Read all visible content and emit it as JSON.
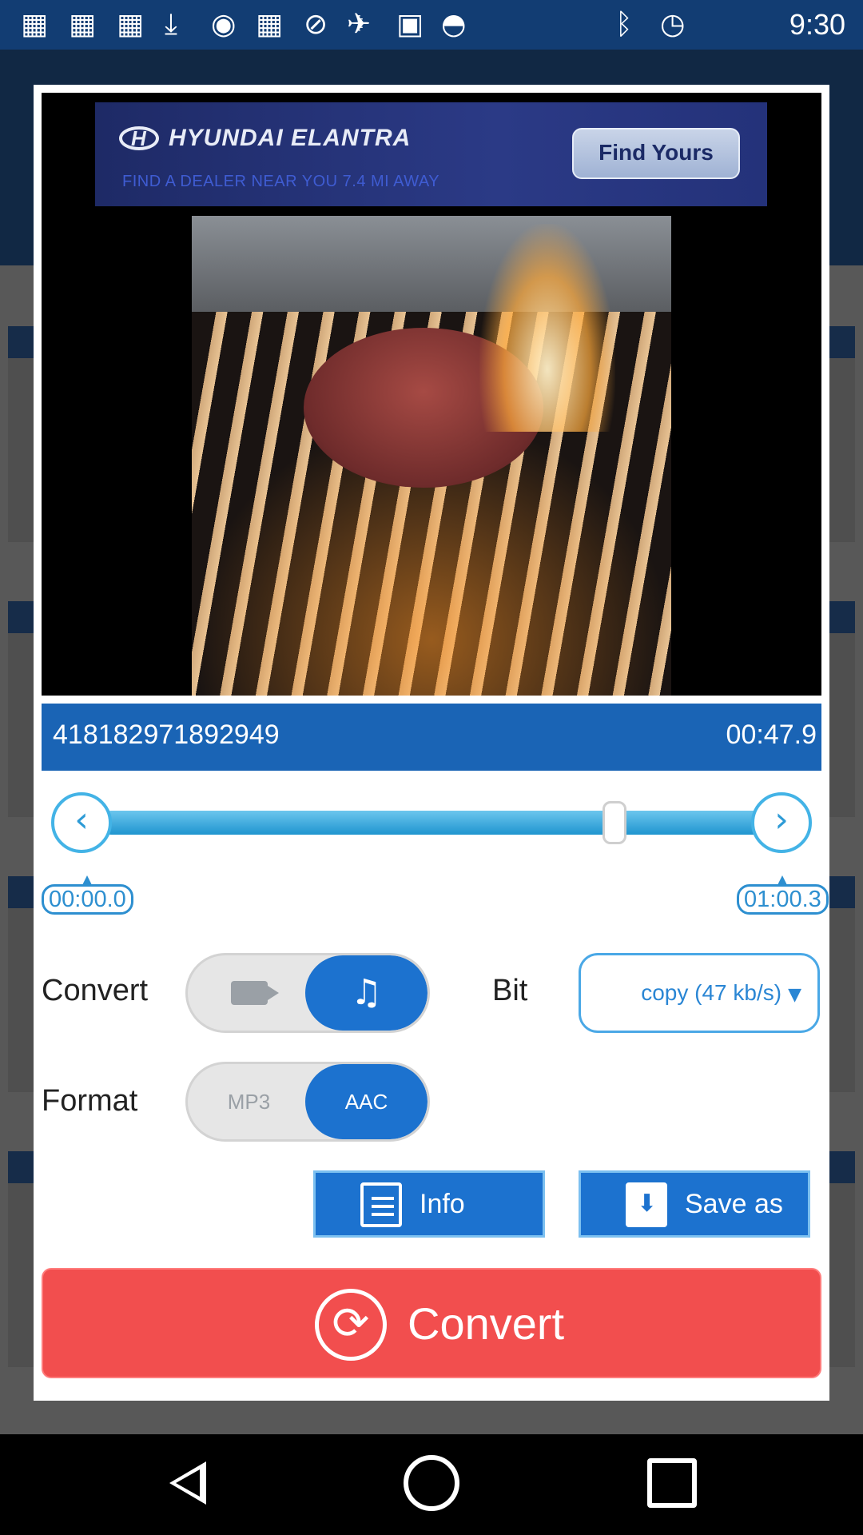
{
  "status_bar": {
    "time": "9:30",
    "icons": [
      "flipboard-icon",
      "flipboard-icon",
      "flipboard-icon",
      "download-icon",
      "record-icon",
      "flipboard-icon",
      "circle-slash-icon",
      "fake-gps-icon",
      "lock-icon",
      "android-icon",
      "bluetooth-icon",
      "alarm-icon"
    ]
  },
  "ad": {
    "brand": "HYUNDAI ELANTRA",
    "subtitle": "FIND A DEALER NEAR YOU 7.4 MI AWAY",
    "cta": "Find Yours"
  },
  "video": {
    "file_name": "418182971892949",
    "duration": "00:47.9"
  },
  "trim": {
    "start_time": "00:00.0",
    "end_time": "01:00.3",
    "handle_position_fraction": 0.77
  },
  "convert_row": {
    "label": "Convert",
    "options": [
      "video",
      "audio"
    ],
    "selected": "audio"
  },
  "bit": {
    "label": "Bit",
    "value": "copy (47 kb/s)"
  },
  "format_row": {
    "label": "Format",
    "options": [
      "MP3",
      "AAC"
    ],
    "selected": "AAC"
  },
  "actions": {
    "info": "Info",
    "save_as": "Save as",
    "convert": "Convert"
  },
  "colors": {
    "accent": "#1c72cf",
    "convert_button": "#f24e4e",
    "header_blue": "#1a64b5"
  }
}
